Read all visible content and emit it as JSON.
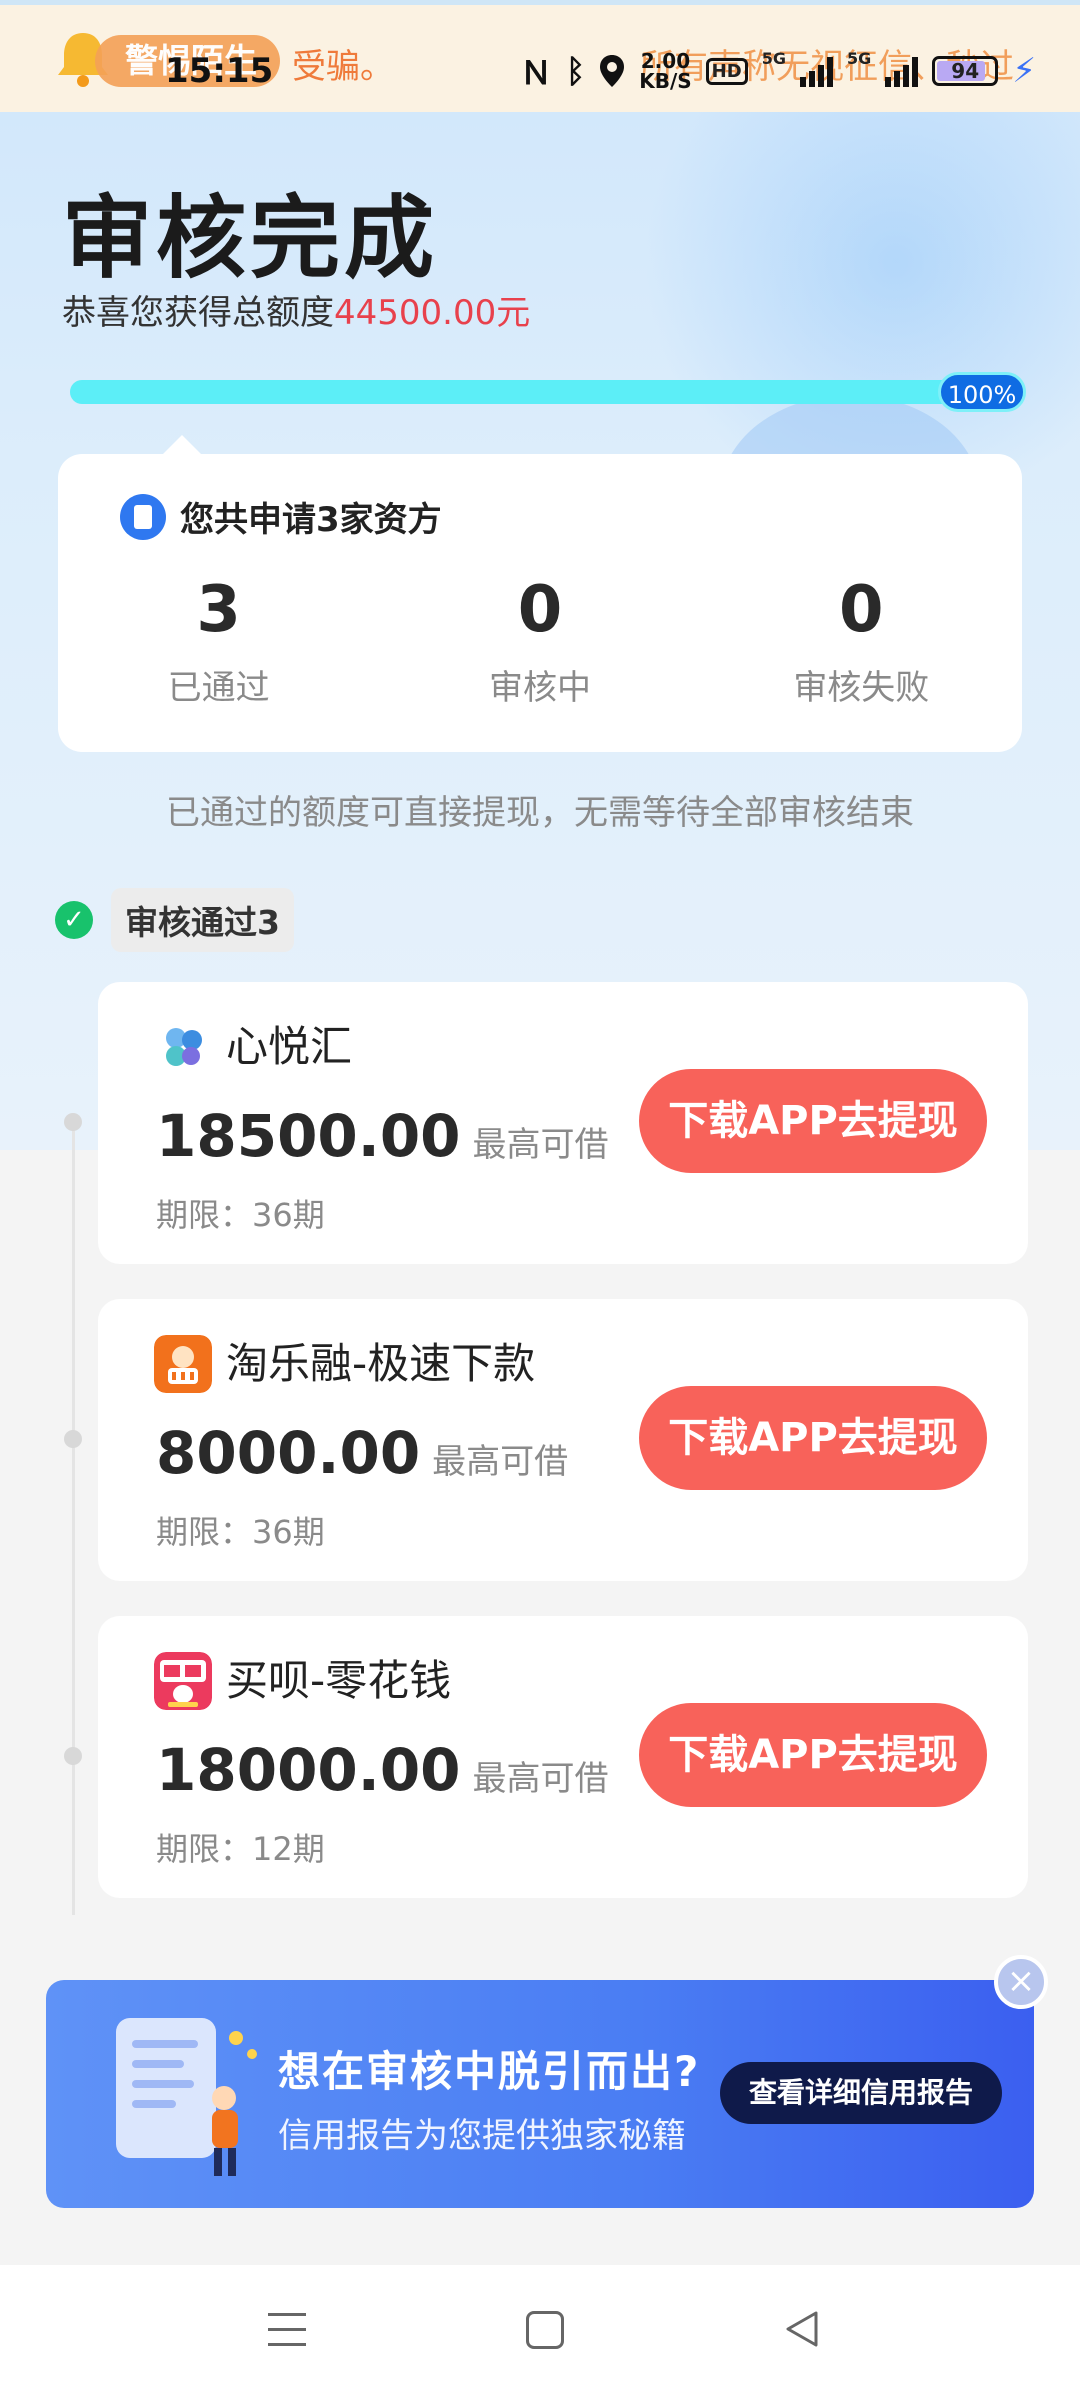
{
  "status_bar": {
    "alert_badge": "警惕陌生",
    "alert_text": "受骗。",
    "alert_text_right": "所有声称无视征信、秒过",
    "time": "15:15",
    "speed_value": "2.00",
    "speed_unit": "KB/S",
    "hd_label": "HD",
    "net_label_1": "5G",
    "net_label_2": "5G",
    "battery": "94"
  },
  "header": {
    "title": "审核完成",
    "subtitle_prefix": "恭喜您获得总额度",
    "subtitle_amount": "44500.00元"
  },
  "progress": {
    "percent": 100,
    "label": "100%"
  },
  "summary": {
    "heading": "您共申请3家资方",
    "stats": [
      {
        "value": "3",
        "label": "已通过"
      },
      {
        "value": "0",
        "label": "审核中"
      },
      {
        "value": "0",
        "label": "审核失败"
      }
    ]
  },
  "hint": "已通过的额度可直接提现，无需等待全部审核结束",
  "passed_section": {
    "label": "审核通过3"
  },
  "lenders": [
    {
      "name": "心悦汇",
      "amount": "18500.00",
      "amount_label": "最高可借",
      "term": "期限：36期",
      "button": "下载APP去提现",
      "logo_icon": "clover-logo-icon"
    },
    {
      "name": "淘乐融-极速下款",
      "amount": "8000.00",
      "amount_label": "最高可借",
      "term": "期限：36期",
      "button": "下载APP去提现",
      "logo_icon": "orange-mascot-logo-icon"
    },
    {
      "name": "买呗-零花钱",
      "amount": "18000.00",
      "amount_label": "最高可借",
      "term": "期限：12期",
      "button": "下载APP去提现",
      "logo_icon": "maibei-logo-icon"
    }
  ],
  "banner": {
    "title": "想在审核中脱引而出?",
    "subtitle": "信用报告为您提供独家秘籍",
    "button": "查看详细信用报告",
    "close_icon": "close-icon"
  },
  "colors": {
    "accent_red": "#e8414c",
    "button_red": "#f8625a",
    "progress_cyan": "#5ceef7",
    "success_green": "#18c26c",
    "banner_blue": "#4a7df3"
  }
}
